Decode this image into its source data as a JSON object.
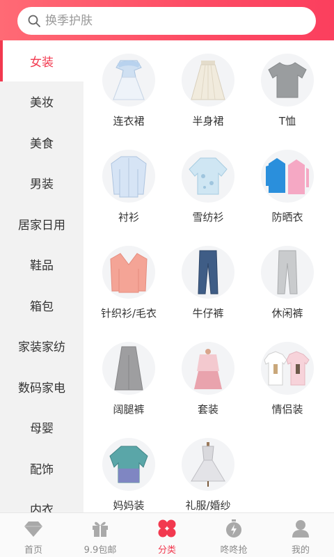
{
  "search": {
    "placeholder": "换季护肤"
  },
  "sidebar": {
    "items": [
      {
        "label": "女装",
        "active": true
      },
      {
        "label": "美妆"
      },
      {
        "label": "美食"
      },
      {
        "label": "男装"
      },
      {
        "label": "居家日用"
      },
      {
        "label": "鞋品"
      },
      {
        "label": "箱包"
      },
      {
        "label": "家装家纺"
      },
      {
        "label": "数码家电"
      },
      {
        "label": "母婴"
      },
      {
        "label": "配饰"
      },
      {
        "label": "内衣"
      }
    ]
  },
  "categories": [
    {
      "label": "连衣裙",
      "icon": "dress-icon"
    },
    {
      "label": "半身裙",
      "icon": "skirt-icon"
    },
    {
      "label": "T恤",
      "icon": "tshirt-icon"
    },
    {
      "label": "衬衫",
      "icon": "shirt-icon"
    },
    {
      "label": "雪纺衫",
      "icon": "chiffon-shirt-icon"
    },
    {
      "label": "防晒衣",
      "icon": "sun-jacket-icon"
    },
    {
      "label": "针织衫/毛衣",
      "icon": "cardigan-icon"
    },
    {
      "label": "牛仔裤",
      "icon": "jeans-icon"
    },
    {
      "label": "休闲裤",
      "icon": "casual-pants-icon"
    },
    {
      "label": "阔腿裤",
      "icon": "wide-leg-pants-icon"
    },
    {
      "label": "套装",
      "icon": "suit-set-icon"
    },
    {
      "label": "情侣装",
      "icon": "couple-tees-icon"
    },
    {
      "label": "妈妈装",
      "icon": "mom-top-icon"
    },
    {
      "label": "礼服/婚纱",
      "icon": "gown-icon"
    }
  ],
  "tabbar": {
    "tabs": [
      {
        "label": "首页",
        "icon": "diamond-icon"
      },
      {
        "label": "9.9包邮",
        "icon": "gift-icon"
      },
      {
        "label": "分类",
        "icon": "clover-icon",
        "active": true
      },
      {
        "label": "咚咚抢",
        "icon": "stopwatch-icon"
      },
      {
        "label": "我的",
        "icon": "user-icon"
      }
    ]
  },
  "colors": {
    "accent": "#f2394f",
    "header_gradient_start": "#ff6a75",
    "header_gradient_end": "#fb3f5e"
  }
}
